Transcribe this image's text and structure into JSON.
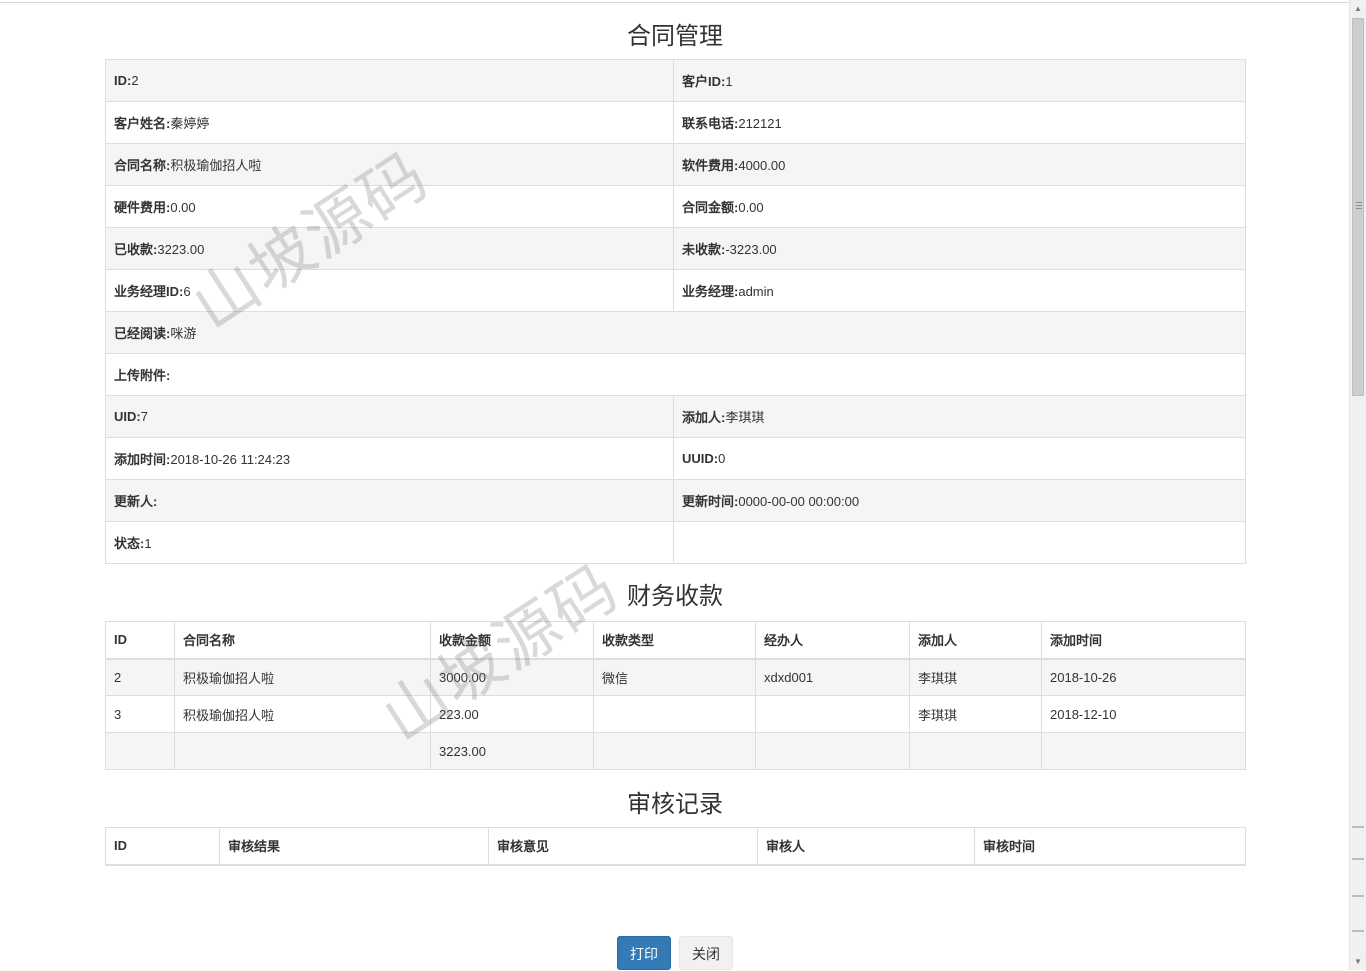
{
  "contract": {
    "title": "合同管理",
    "rows": [
      [
        {
          "label": "ID:",
          "value": "2"
        },
        {
          "label": "客户ID:",
          "value": "1"
        }
      ],
      [
        {
          "label": "客户姓名:",
          "value": "秦婷婷"
        },
        {
          "label": "联系电话:",
          "value": "212121"
        }
      ],
      [
        {
          "label": "合同名称:",
          "value": "积极瑜伽招人啦"
        },
        {
          "label": "软件费用:",
          "value": "4000.00"
        }
      ],
      [
        {
          "label": "硬件费用:",
          "value": "0.00"
        },
        {
          "label": "合同金额:",
          "value": "0.00"
        }
      ],
      [
        {
          "label": "已收款:",
          "value": "3223.00"
        },
        {
          "label": "未收款:",
          "value": "-3223.00"
        }
      ],
      [
        {
          "label": "业务经理ID:",
          "value": "6"
        },
        {
          "label": "业务经理:",
          "value": "admin"
        }
      ],
      [
        {
          "label": "已经阅读:",
          "value": "咪游"
        }
      ],
      [
        {
          "label": "上传附件:",
          "value": ""
        }
      ],
      [
        {
          "label": "UID:",
          "value": "7"
        },
        {
          "label": "添加人:",
          "value": "李琪琪"
        }
      ],
      [
        {
          "label": "添加时间:",
          "value": "2018-10-26 11:24:23"
        },
        {
          "label": "UUID:",
          "value": "0"
        }
      ],
      [
        {
          "label": "更新人:",
          "value": ""
        },
        {
          "label": "更新时间:",
          "value": "0000-00-00 00:00:00"
        }
      ],
      [
        {
          "label": "状态:",
          "value": "1"
        },
        {
          "label": "",
          "value": ""
        }
      ]
    ]
  },
  "finance": {
    "title": "财务收款",
    "headers": [
      "ID",
      "合同名称",
      "收款金额",
      "收款类型",
      "经办人",
      "添加人",
      "添加时间"
    ],
    "rows": [
      [
        "2",
        "积极瑜伽招人啦",
        "3000.00",
        "微信",
        "xdxd001",
        "李琪琪",
        "2018-10-26"
      ],
      [
        "3",
        "积极瑜伽招人啦",
        "223.00",
        "",
        "",
        "李琪琪",
        "2018-12-10"
      ],
      [
        "",
        "",
        "3223.00",
        "",
        "",
        "",
        ""
      ]
    ]
  },
  "audit": {
    "title": "审核记录",
    "headers": [
      "ID",
      "审核结果",
      "审核意见",
      "审核人",
      "审核时间"
    ]
  },
  "buttons": {
    "print": "打印",
    "close": "关闭"
  },
  "watermark": "山坡源码",
  "colors": {
    "primary": "#337ab7",
    "stripe": "#f5f5f5",
    "border": "#dddddd"
  }
}
